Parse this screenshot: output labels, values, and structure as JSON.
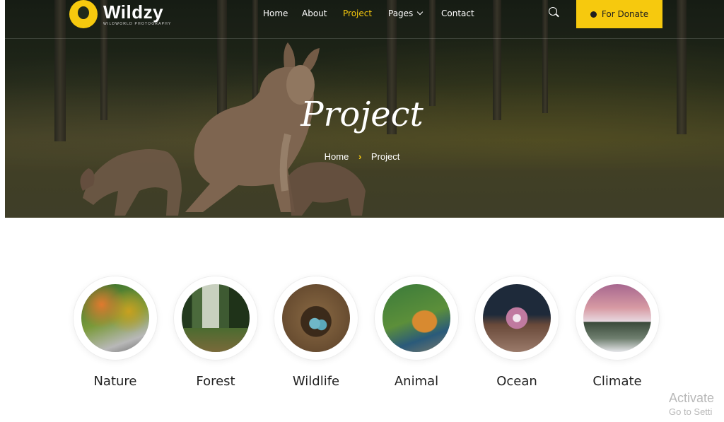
{
  "brand": {
    "name": "Wildzy",
    "tagline": "WILDWORLD PHOTOGRAPHY"
  },
  "nav": {
    "items": [
      {
        "label": "Home"
      },
      {
        "label": "About"
      },
      {
        "label": "Project"
      },
      {
        "label": "Pages"
      },
      {
        "label": "Contact"
      }
    ],
    "active": "Project",
    "search_icon": "search-icon",
    "donate_label": "For Donate",
    "accent_color": "#f6c90e"
  },
  "hero": {
    "title": "Project",
    "breadcrumb": {
      "home": "Home",
      "current": "Project"
    }
  },
  "categories": [
    {
      "label": "Nature"
    },
    {
      "label": "Forest"
    },
    {
      "label": "Wildlife"
    },
    {
      "label": "Animal"
    },
    {
      "label": "Ocean"
    },
    {
      "label": "Climate"
    }
  ],
  "watermark": {
    "line1": "Activate",
    "line2": "Go to Setti"
  }
}
